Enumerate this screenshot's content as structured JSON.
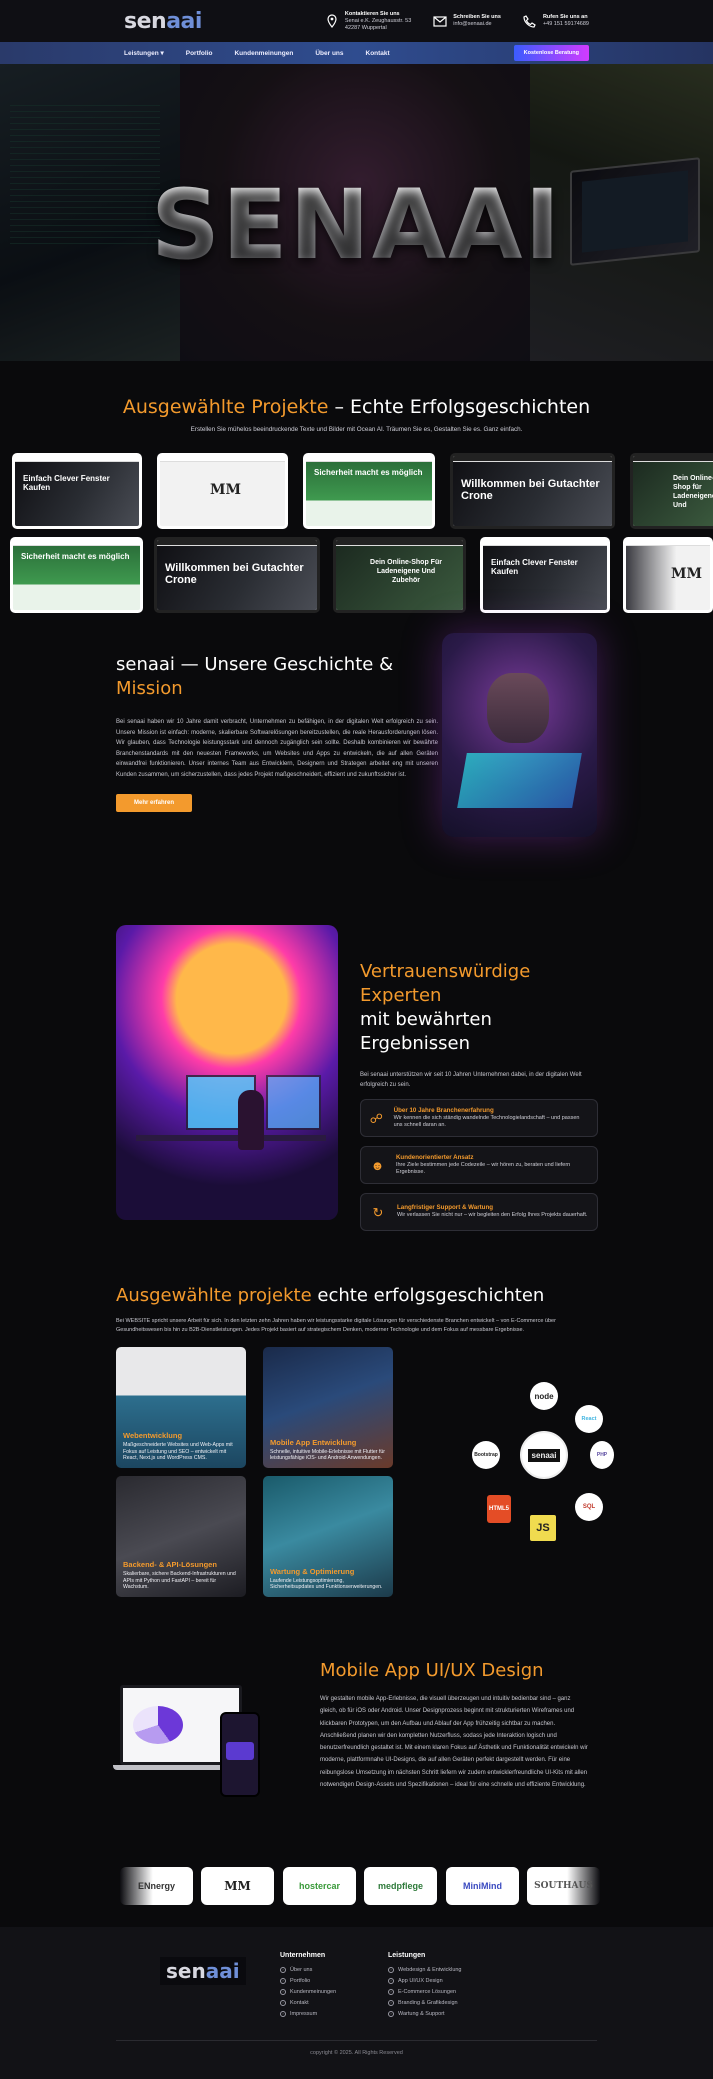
{
  "brand": {
    "logo_main": "sen",
    "logo_ai": "aai"
  },
  "contact": [
    {
      "title": "Kontaktieren Sie uns",
      "line1": "Senai e.K. Zeughausstr. 53",
      "line2": "42287 Wuppertal",
      "icon": "location-pin-icon"
    },
    {
      "title": "Schreiben Sie uns",
      "line1": "info@senaai.de",
      "line2": "",
      "icon": "envelope-icon"
    },
    {
      "title": "Rufen Sie uns an",
      "line1": "+49 151 59174689",
      "line2": "",
      "icon": "phone-icon"
    }
  ],
  "nav": {
    "items": [
      "Leistungen ▾",
      "Portfolio",
      "Kundenmeinungen",
      "Über uns",
      "Kontakt"
    ],
    "cta": "Kostenlose Beratung"
  },
  "hero": {
    "title": "SENAAI"
  },
  "projects": {
    "title_accent": "Ausgewählte Projekte",
    "title_rest": " – Echte Erfolgsgeschichten",
    "subtitle": "Erstellen Sie mühelos beeindruckende Texte und Bilder mit Ocean AI. Träumen Sie es, Gestalten Sie es. Ganz einfach.",
    "row1": [
      {
        "label": "Einfach Clever Fenster Kaufen",
        "style": "dark"
      },
      {
        "label": "MM",
        "style": "white"
      },
      {
        "label": "Sicherheit macht es möglich",
        "style": "green"
      },
      {
        "label": "Willkommen bei Gutachter Crone",
        "style": "dark"
      },
      {
        "label": "Dein Online-Shop für Ladeneigene Und",
        "style": "dark"
      }
    ],
    "row2": [
      {
        "label": "Sicherheit macht es möglich",
        "style": "green"
      },
      {
        "label": "Willkommen bei Gutachter Crone",
        "style": "dark"
      },
      {
        "label": "Dein Online-Shop Für Ladeneigene Und Zubehör",
        "style": "dark"
      },
      {
        "label": "Einfach Clever Fenster Kaufen",
        "style": "dark"
      },
      {
        "label": "MM",
        "style": "white"
      }
    ]
  },
  "story": {
    "title_main": "senaai — Unsere Geschichte &",
    "title_accent": "Mission",
    "body": "Bei senaai haben wir 10 Jahre damit verbracht, Unternehmen zu befähigen, in der digitalen Welt erfolgreich zu sein. Unsere Mission ist einfach: moderne, skalierbare Softwarelösungen bereitzustellen, die reale Herausforderungen lösen. Wir glauben, dass Technologie leistungsstark und dennoch zugänglich sein sollte. Deshalb kombinieren wir bewährte Branchenstandards mit den neuesten Frameworks, um Websites und Apps zu entwickeln, die auf allen Geräten einwandfrei funktionieren. Unser internes Team aus Entwicklern, Designern und Strategen arbeitet eng mit unseren Kunden zusammen, um sicherzustellen, dass jedes Projekt maßgeschneidert, effizient und zukunftssicher ist.",
    "button": "Mehr erfahren"
  },
  "experts": {
    "title_accent": "Vertrauenswürdige Experten",
    "title_rest": "mit bewährten Ergebnissen",
    "lead": "Bei senaai unterstützen wir seit 10 Jahren Unternehmen dabei, in der digitalen Welt erfolgreich zu sein.",
    "features": [
      {
        "icon": "handshake-icon",
        "title": "Über 10 Jahre Branchenerfahrung",
        "text": "Wir kennen die sich ständig wandelnde Technologielandschaft – und passen uns schnell daran an."
      },
      {
        "icon": "people-icon",
        "title": "Kundenorientierter Ansatz",
        "text": "Ihre Ziele bestimmen jede Codezeile – wir hören zu, beraten und liefern Ergebnisse."
      },
      {
        "icon": "support-icon",
        "title": "Langfristiger Support & Wartung",
        "text": "Wir verlassen Sie nicht nur – wir begleiten den Erfolg Ihres Projekts dauerhaft."
      }
    ]
  },
  "services": {
    "title_accent": "Ausgewählte projekte",
    "title_rest": " echte erfolgsgeschichten",
    "lead": "Bei WEBSITE spricht unsere Arbeit für sich. In den letzten zehn Jahren haben wir leistungsstarke digitale Lösungen für verschiedenste Branchen entwickelt – von E-Commerce über Gesundheitswesen bis hin zu B2B-Dienstleistungen. Jedes Projekt basiert auf strategischem Denken, moderner Technologie und dem Fokus auf messbare Ergebnisse.",
    "cards": [
      {
        "title": "Webentwicklung",
        "text": "Maßgeschneiderte Websites und Web-Apps mit Fokus auf Leistung und SEO – entwickelt mit React, Next.js und WordPress CMS."
      },
      {
        "title": "Mobile App Entwicklung",
        "text": "Schnelle, intuitive Mobile-Erlebnisse mit Flutter für leistungsfähige iOS- und Android-Anwendungen."
      },
      {
        "title": "Backend- & API-Lösungen",
        "text": "Skalierbare, sichere Backend-Infrastrukturen und APIs mit Python und FastAPI – bereit für Wachstum."
      },
      {
        "title": "Wartung & Optimierung",
        "text": "Laufende Leistungsoptimierung, Sicherheitsupdates und Funktionserweiterungen."
      }
    ],
    "tech": [
      "node",
      "React",
      "senaai",
      "Bootstrap",
      "HTML5",
      "JS",
      "SQL",
      "PHP"
    ]
  },
  "mobile": {
    "title": "Mobile App UI/UX Design",
    "body": "Wir gestalten mobile App-Erlebnisse, die visuell überzeugen und intuitiv bedienbar sind – ganz gleich, ob für iOS oder Android. Unser Designprozess beginnt mit strukturierten Wireframes und klickbaren Prototypen, um den Aufbau und Ablauf der App frühzeitig sichtbar zu machen. Anschließend planen wir den kompletten Nutzerfluss, sodass jede Interaktion logisch und benutzerfreundlich gestaltet ist. Mit einem klaren Fokus auf Ästhetik und Funktionalität entwickeln wir moderne, plattformnahe UI-Designs, die auf allen Geräten perfekt dargestellt werden. Für eine reibungslose Umsetzung im nächsten Schritt liefern wir zudem entwicklerfreundliche UI-Kits mit allen notwendigen Design-Assets und Spezifikationen – ideal für eine schnelle und effiziente Entwicklung."
  },
  "clients": [
    "ENnergy",
    "MM",
    "hostercar",
    "medpflege",
    "MiniMind",
    "SOUTHAUS"
  ],
  "footer": {
    "col1_title": "Unternehmen",
    "col1": [
      "Über uns",
      "Portfolio",
      "Kundenmeinungen",
      "Kontakt",
      "Impressum"
    ],
    "col2_title": "Leistungen",
    "col2": [
      "Webdesign & Entwicklung",
      "App UI/UX Design",
      "E-Commerce Lösungen",
      "Branding & Grafikdesign",
      "Wartung & Support"
    ],
    "copyright": "copyright © 2025. All Rights Reserved"
  },
  "colors": {
    "accent": "#f39a2d",
    "nav": "#2f4c8f",
    "cta_start": "#3b5cff",
    "cta_end": "#d13bff"
  }
}
